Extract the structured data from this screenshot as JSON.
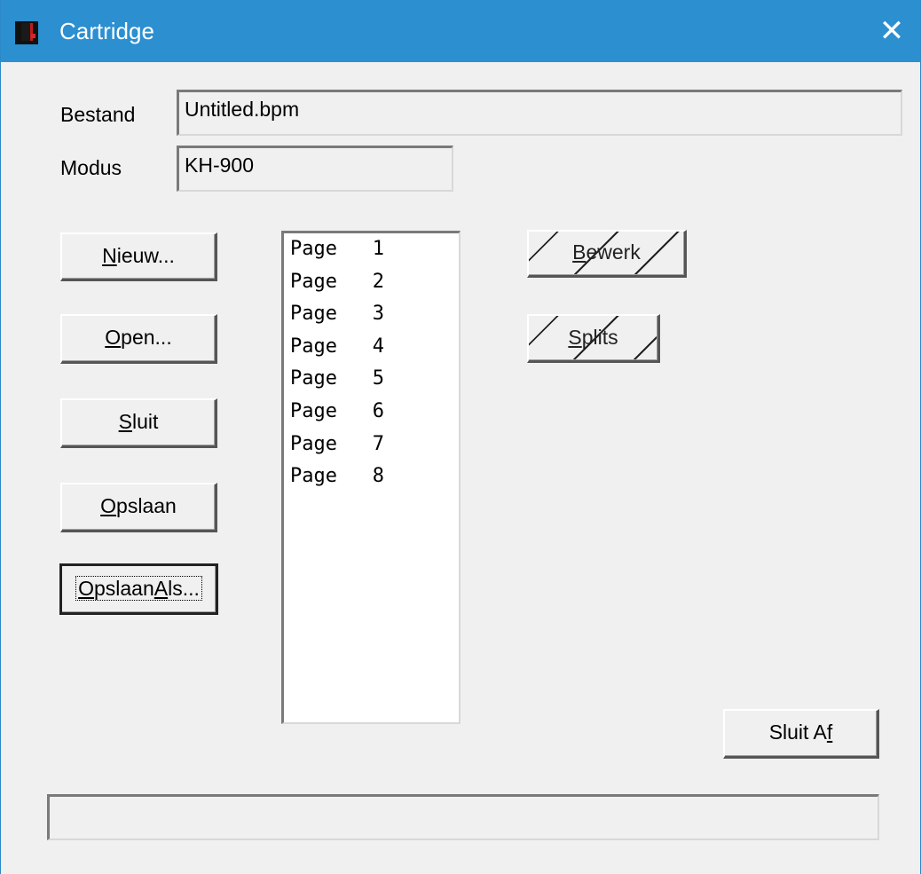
{
  "window": {
    "title": "Cartridge",
    "close_glyph": "✕",
    "app_icon": "cartridge-app-icon"
  },
  "fields": {
    "bestand_label": "Bestand",
    "bestand_value": "Untitled.bpm",
    "modus_label": "Modus",
    "modus_value": "KH-900"
  },
  "buttons": {
    "nieuw": {
      "pre": "",
      "accel": "N",
      "post": "ieuw..."
    },
    "open": {
      "pre": "",
      "accel": "O",
      "post": "pen..."
    },
    "sluit": {
      "pre": "",
      "accel": "S",
      "post": "luit"
    },
    "opslaan": {
      "pre": "",
      "accel": "O",
      "post": "pslaan"
    },
    "opslaan_als": {
      "pre": "",
      "accel": "O",
      "mid": "pslaan ",
      "accel2": "A",
      "post": "ls..."
    },
    "bewerk": {
      "pre": "",
      "accel": "B",
      "post": "ewerk"
    },
    "splits": {
      "pre": "",
      "accel": "S",
      "post": "plits"
    },
    "sluit_af": {
      "pre": "Sluit A",
      "accel": "f",
      "post": ""
    }
  },
  "pages_list": [
    "Page   1",
    "Page   2",
    "Page   3",
    "Page   4",
    "Page   5",
    "Page   6",
    "Page   7",
    "Page   8"
  ],
  "status_text": ""
}
